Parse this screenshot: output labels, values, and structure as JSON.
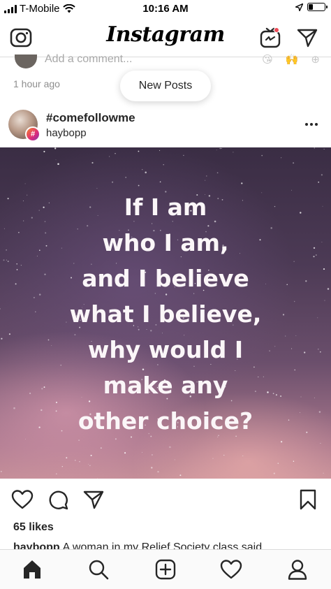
{
  "status_bar": {
    "carrier": "T-Mobile",
    "time": "10:16 AM",
    "battery_level": 0.25
  },
  "header": {
    "logo_text": "Instagram",
    "icons": [
      "camera-icon",
      "igtv-icon",
      "direct-message-icon"
    ]
  },
  "previous_post": {
    "comment_placeholder": "Add a comment...",
    "reactions": [
      "😘",
      "🙌",
      "⊕"
    ],
    "timestamp": "1 hour ago"
  },
  "new_posts_pill": "New Posts",
  "post": {
    "title": "#comefollowme",
    "username": "haybopp",
    "badge": "#",
    "quote_lines": [
      "If I am",
      "who I am,",
      "and I believe",
      "what I believe,",
      "why would I",
      "make any",
      "other choice?"
    ],
    "likes": "65 likes",
    "caption_user": "haybopp",
    "caption_text": "A woman in my Relief Society class said"
  },
  "tab_bar": {
    "tabs": [
      "home-icon",
      "search-icon",
      "new-post-icon",
      "activity-heart-icon",
      "profile-icon"
    ]
  },
  "colors": {
    "notification_dot": "#ed4956",
    "text": "#262626",
    "secondary_text": "#8e8e8e"
  }
}
